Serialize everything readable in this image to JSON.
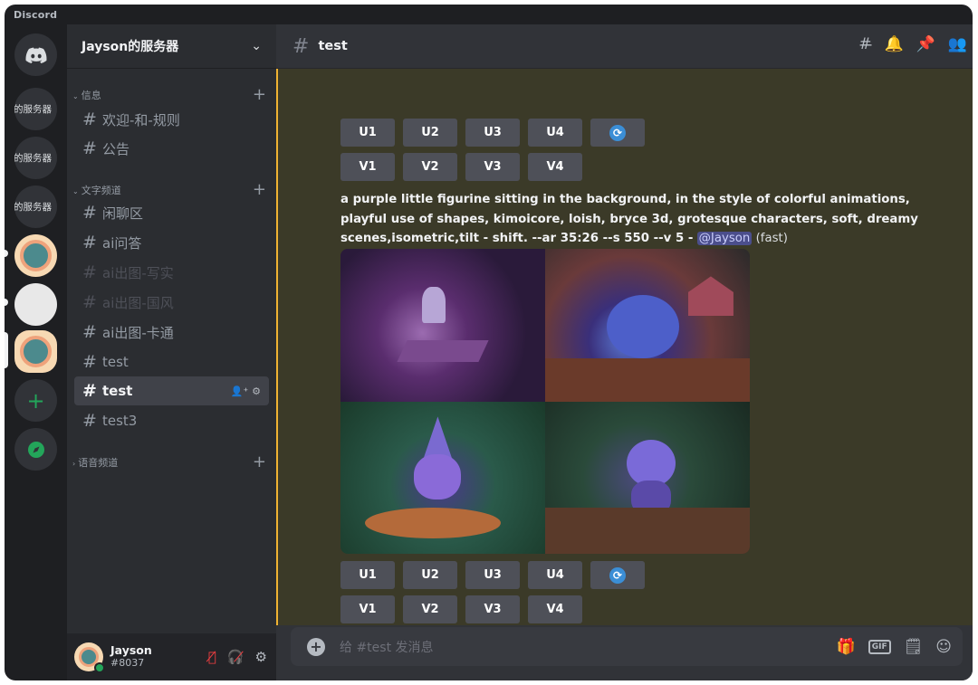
{
  "app": {
    "title": "Discord"
  },
  "servers": {
    "items": [
      {
        "label": "的服务器"
      },
      {
        "label": "的服务器"
      },
      {
        "label": "的服务器"
      }
    ]
  },
  "sidebar": {
    "guild_name": "Jayson的服务器",
    "categories": [
      {
        "label": "信息"
      },
      {
        "label": "文字频道"
      },
      {
        "label": "语音频道"
      }
    ],
    "channels": [
      {
        "label": "欢迎-和-规则"
      },
      {
        "label": "公告"
      },
      {
        "label": "闲聊区"
      },
      {
        "label": "ai问答"
      },
      {
        "label": "ai出图-写实"
      },
      {
        "label": "ai出图-国风"
      },
      {
        "label": "ai出图-卡通"
      },
      {
        "label": "test"
      },
      {
        "label": "test"
      },
      {
        "label": "test3"
      }
    ]
  },
  "user": {
    "name": "Jayson",
    "tag": "#8037"
  },
  "header": {
    "channel": "test"
  },
  "message": {
    "prompt": "a purple little figurine sitting in the background, in the style of colorful animations, playful use of shapes, kimoicore, loish, bryce 3d, grotesque characters, soft, dreamy scenes,isometric,tilt - shift. --ar 35:26 --s 550 --v 5 -",
    "mention": "@Jayson",
    "speed": "(fast)"
  },
  "buttons": {
    "upscale": [
      "U1",
      "U2",
      "U3",
      "U4"
    ],
    "variation": [
      "V1",
      "V2",
      "V3",
      "V4"
    ],
    "reroll_icon": "refresh-icon"
  },
  "composer": {
    "placeholder": "给 #test 发消息"
  },
  "colors": {
    "accent": "#5865f2",
    "online": "#23a55a",
    "mention_bar": "#f0b232"
  }
}
